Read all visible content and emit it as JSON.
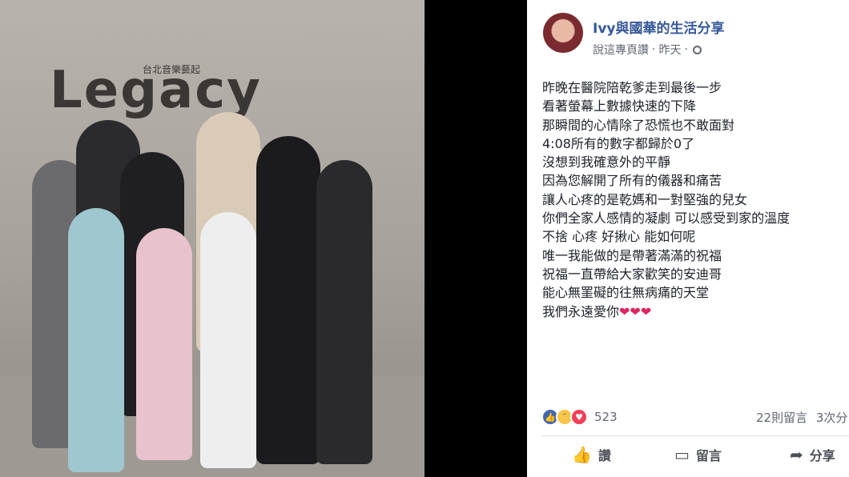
{
  "post": {
    "page_name": "Ivy與國華的生活分享",
    "like_page_label": "說這專頁讚",
    "separator": "·",
    "time": "昨天",
    "time_dot": "·",
    "privacy_icon": "globe-icon",
    "lines": [
      "昨晚在醫院陪乾爹走到最後一步",
      "看著螢幕上數據快速的下降",
      "那瞬間的心情除了恐慌也不敢面對",
      "4:08所有的數字都歸於0了",
      "沒想到我確意外的平靜",
      "因為您解開了所有的儀器和痛苦",
      "讓人心疼的是乾媽和一對堅強的兒女",
      "你們全家人感情的凝劇 可以感受到家的溫度",
      "不捨 心疼 好揪心 能如何呢",
      "唯一我能做的是帶著滿滿的祝福",
      "祝福一直帶給大家歡笑的安迪哥",
      "能心無罣礙的往無病痛的天堂",
      "我們永遠愛你"
    ],
    "hearts": "❤❤❤"
  },
  "stats": {
    "reaction_icons": [
      "like-icon",
      "sad-icon",
      "love-icon"
    ],
    "reaction_count": "523",
    "comments": "22則留言",
    "shares": "3次分"
  },
  "actions": {
    "like_label": "讚",
    "comment_label": "留言",
    "share_label": "分享"
  },
  "photo": {
    "sign_text": "Legacy",
    "sign_sub": "台北音樂藝起"
  },
  "colors": {
    "link_blue": "#365899",
    "meta_gray": "#616770",
    "like_blue": "#4267b2",
    "love_red": "#f33e58"
  }
}
